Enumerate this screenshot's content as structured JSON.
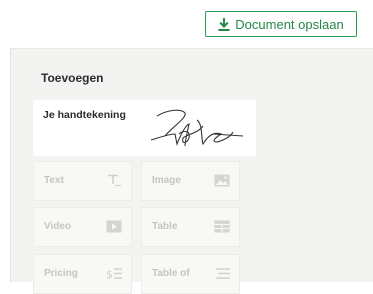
{
  "toolbar": {
    "save_label": "Document opslaan",
    "accent_color": "#2b9a55"
  },
  "panel": {
    "title": "Toevoegen",
    "signature": {
      "label": "Je handtekening"
    },
    "blocks": [
      {
        "label": "Text",
        "icon": "text-icon"
      },
      {
        "label": "Image",
        "icon": "image-icon"
      },
      {
        "label": "Video",
        "icon": "video-icon"
      },
      {
        "label": "Table",
        "icon": "table-icon"
      },
      {
        "label": "Pricing",
        "icon": "pricing-icon"
      },
      {
        "label": "Table of",
        "icon": "toc-icon"
      }
    ]
  }
}
